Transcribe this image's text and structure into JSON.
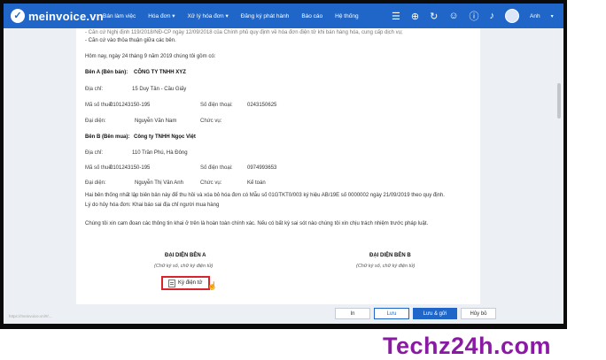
{
  "app": {
    "logo_text": "meinvoice.vn"
  },
  "nav": {
    "items": [
      "Bán làm việc",
      "Hóa đơn ▾",
      "Xử lý hóa đơn ▾",
      "Đăng ký phát hành",
      "Báo cáo",
      "Hệ thống"
    ]
  },
  "user": {
    "name": "Anh"
  },
  "doc": {
    "top_partial": "- Căn cứ Nghị định 119/2018/NĐ-CP ngày 12/09/2018 của Chính phủ quy định về hóa đơn điện tử khi bán hàng hóa, cung cấp dịch vụ;",
    "basis_line": "- Căn cứ vào thỏa thuận giữa các bên.",
    "date_line": "Hôm nay, ngày  24  tháng  9  năm  2019  chúng tôi gồm có:",
    "party_a": {
      "heading": "Bên A (Bên bán):",
      "company": "CÔNG TY TNHH XYZ",
      "address_label": "Địa chỉ:",
      "address": "15 Duy Tân - Cầu Giấy",
      "tax_label": "Mã số thuế:",
      "tax": "0101243150-195",
      "phone_label": "Số điện thoại:",
      "phone": "0243150625",
      "rep_label": "Đại diện:",
      "rep": "Nguyễn Văn Nam",
      "role_label": "Chức vụ:",
      "role": ""
    },
    "party_b": {
      "heading": "Bên B (Bên mua):",
      "company": "Công ty TNHH Ngọc Việt",
      "address_label": "Địa chỉ:",
      "address": "110 Trần Phú, Hà Đông",
      "tax_label": "Mã số thuế:",
      "tax": "0101243150-195",
      "phone_label": "Số điện thoại:",
      "phone": "0974993653",
      "rep_label": "Đại diện:",
      "rep": "Nguyễn Thị Vân Anh",
      "role_label": "Chức vụ:",
      "role": "Kế toán"
    },
    "agreement": "Hai bên thống nhất lập biên bản này để thu hồi và xóa bỏ hóa đơn có Mẫu số 01GTKT0/003 ký hiệu AB/19E số 0000002 ngày 21/09/2019 theo quy định.",
    "reason": "Lý do hủy hóa đơn: Khai báo sai địa chỉ người mua hàng",
    "commitment": "Chúng tôi xin cam đoan các thông tin khai ở trên là hoàn toàn chính xác. Nếu có bất kỳ sai sót nào chúng tôi xin chịu trách nhiệm trước pháp luật.",
    "sign_a_title": "ĐẠI DIỆN BÊN A",
    "sign_a_sub": "(Chữ ký số, chữ ký điện tử)",
    "sign_b_title": "ĐẠI DIỆN BÊN B",
    "sign_b_sub": "(Chữ ký số, chữ ký điện tử)",
    "sign_button": "Ký điện tử"
  },
  "footer": {
    "url": "https://meinvoice.vn/#/...",
    "buttons": [
      "In",
      "Lưu",
      "Lưu & gửi",
      "Hủy bỏ"
    ]
  },
  "watermark": "Techz24h.com",
  "colors": {
    "topbar": "#1f66c8",
    "highlight": "#d9232d",
    "watermark": "#8a1aa3"
  }
}
